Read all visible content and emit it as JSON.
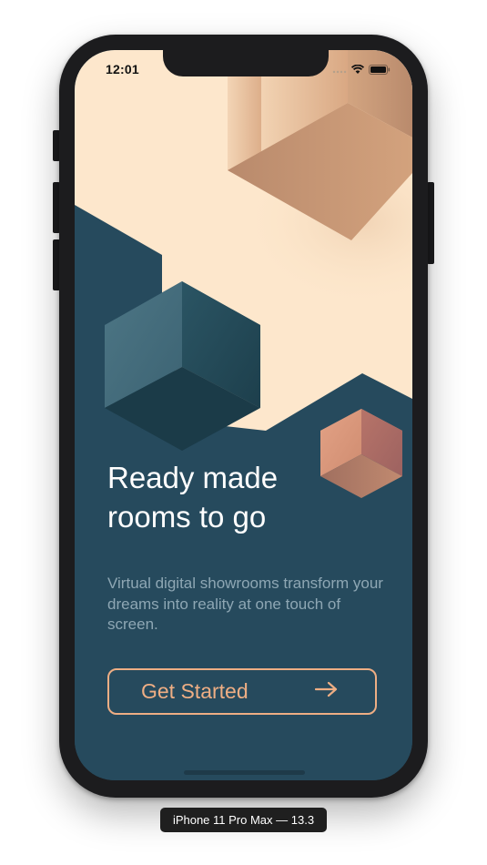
{
  "status_bar": {
    "time": "12:01"
  },
  "onboarding": {
    "headline_line1": "Ready made",
    "headline_line2": "rooms to go",
    "description": "Virtual digital showrooms transform your dreams into reality at one touch of screen.",
    "cta_label": "Get Started",
    "cta_icon": "arrow-right-icon"
  },
  "device_label": "iPhone 11 Pro Max — 13.3",
  "colors": {
    "background_dark": "#264a5d",
    "background_light": "#fde7cc",
    "accent": "#eeae84",
    "headline": "#ffffff",
    "subtext": "#8ea7b4"
  }
}
